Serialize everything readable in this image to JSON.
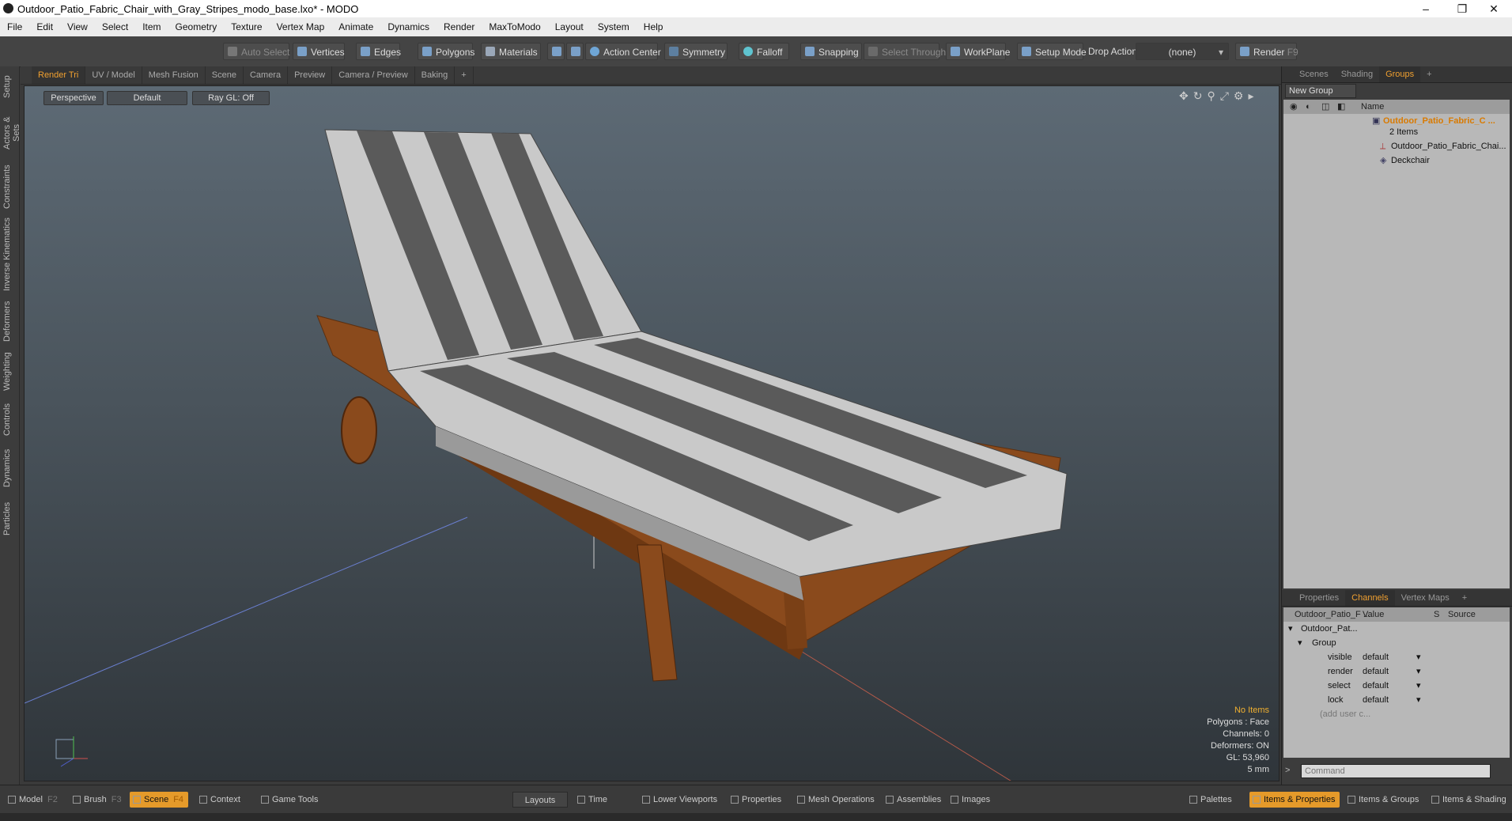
{
  "window": {
    "title": "Outdoor_Patio_Fabric_Chair_with_Gray_Stripes_modo_base.lxo* - MODO",
    "controls": [
      "–",
      "❐",
      "✕"
    ]
  },
  "menu": [
    "File",
    "Edit",
    "View",
    "Select",
    "Item",
    "Geometry",
    "Texture",
    "Vertex Map",
    "Animate",
    "Dynamics",
    "Render",
    "MaxToModo",
    "Layout",
    "System",
    "Help"
  ],
  "toolbar": {
    "auto_select": "Auto Select",
    "vertices": "Vertices",
    "edges": "Edges",
    "polygons": "Polygons",
    "materials": "Materials",
    "action_center": "Action Center",
    "symmetry": "Symmetry",
    "falloff": "Falloff",
    "snapping": "Snapping",
    "select_through": "Select Through",
    "workplane": "WorkPlane",
    "setup_mode": "Setup Mode",
    "drop_action": "Drop Action",
    "drop_value": "(none)",
    "render": "Render",
    "render_key": "F9"
  },
  "left_tabs": [
    "Setup",
    "Actors & Sets",
    "Constraints",
    "Inverse Kinematics",
    "Deformers",
    "Weighting",
    "Controls",
    "Dynamics",
    "Particles"
  ],
  "viewport_tabs": [
    "Render Tri",
    "UV / Model",
    "Mesh Fusion",
    "Scene",
    "Camera",
    "Preview",
    "Camera / Preview",
    "Baking",
    "+"
  ],
  "viewport": {
    "view": "Perspective",
    "shading": "Default",
    "raygl": "Ray GL: Off",
    "hud": {
      "items": "No Items",
      "polygons": "Polygons : Face",
      "channels": "Channels: 0",
      "deformers": "Deformers: ON",
      "gl": "GL: 53,960",
      "unit": "5 mm"
    }
  },
  "right_top_tabs": [
    "Scenes",
    "Shading",
    "Groups",
    "+"
  ],
  "groups": {
    "new_group": "New Group",
    "name_header": "Name",
    "root": "Outdoor_Patio_Fabric_C ...",
    "count": "2 Items",
    "children": [
      "Outdoor_Patio_Fabric_Chai...",
      "Deckchair"
    ]
  },
  "right_bottom_tabs": [
    "Properties",
    "Channels",
    "Vertex Maps",
    "+"
  ],
  "channels": {
    "col_name": "Outdoor_Patio_F ...",
    "col_value": "Value",
    "col_s": "S",
    "col_source": "Source",
    "root": "Outdoor_Pat...",
    "group": "Group",
    "rows": [
      {
        "name": "visible",
        "value": "default"
      },
      {
        "name": "render",
        "value": "default"
      },
      {
        "name": "select",
        "value": "default"
      },
      {
        "name": "lock",
        "value": "default"
      }
    ],
    "add_user": "(add user c..."
  },
  "command_placeholder": "Command",
  "bottom": {
    "model": "Model",
    "model_key": "F2",
    "brush": "Brush",
    "brush_key": "F3",
    "scene": "Scene",
    "scene_key": "F4",
    "context": "Context",
    "game_tools": "Game Tools",
    "layouts": "Layouts",
    "time": "Time",
    "lower_viewports": "Lower Viewports",
    "properties": "Properties",
    "mesh_operations": "Mesh Operations",
    "assemblies": "Assemblies",
    "images": "Images",
    "palettes": "Palettes",
    "items_properties": "Items & Properties",
    "items_groups": "Items & Groups",
    "items_shading": "Items & Shading"
  },
  "colors": {
    "accent": "#f0a030",
    "active_tab": "#e59a2a",
    "wood": "#8a4a1c",
    "stripe_dark": "#5a5a5a",
    "stripe_light": "#cfcfcf"
  }
}
